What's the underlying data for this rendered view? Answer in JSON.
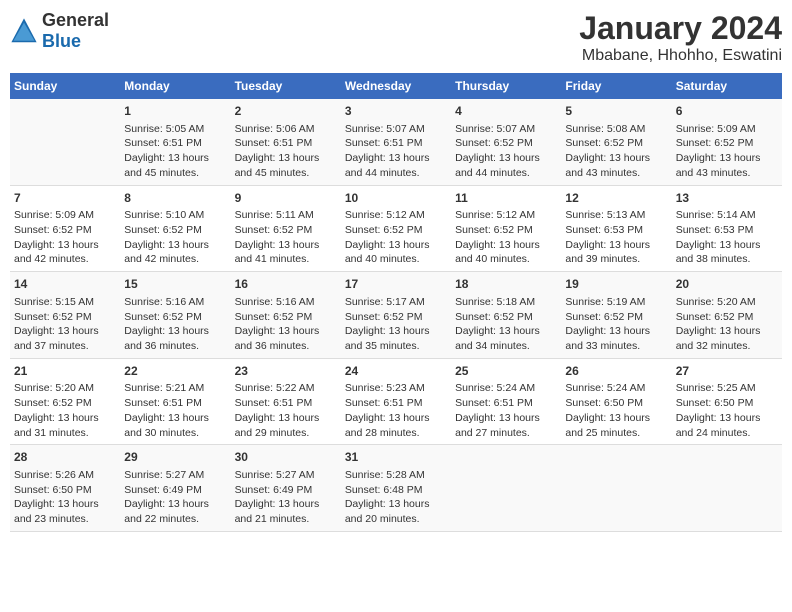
{
  "header": {
    "logo": {
      "general": "General",
      "blue": "Blue"
    },
    "title": "January 2024",
    "subtitle": "Mbabane, Hhohho, Eswatini"
  },
  "weekdays": [
    "Sunday",
    "Monday",
    "Tuesday",
    "Wednesday",
    "Thursday",
    "Friday",
    "Saturday"
  ],
  "weeks": [
    [
      {
        "day": "",
        "sunrise": "",
        "sunset": "",
        "daylight": ""
      },
      {
        "day": "1",
        "sunrise": "Sunrise: 5:05 AM",
        "sunset": "Sunset: 6:51 PM",
        "daylight": "Daylight: 13 hours and 45 minutes."
      },
      {
        "day": "2",
        "sunrise": "Sunrise: 5:06 AM",
        "sunset": "Sunset: 6:51 PM",
        "daylight": "Daylight: 13 hours and 45 minutes."
      },
      {
        "day": "3",
        "sunrise": "Sunrise: 5:07 AM",
        "sunset": "Sunset: 6:51 PM",
        "daylight": "Daylight: 13 hours and 44 minutes."
      },
      {
        "day": "4",
        "sunrise": "Sunrise: 5:07 AM",
        "sunset": "Sunset: 6:52 PM",
        "daylight": "Daylight: 13 hours and 44 minutes."
      },
      {
        "day": "5",
        "sunrise": "Sunrise: 5:08 AM",
        "sunset": "Sunset: 6:52 PM",
        "daylight": "Daylight: 13 hours and 43 minutes."
      },
      {
        "day": "6",
        "sunrise": "Sunrise: 5:09 AM",
        "sunset": "Sunset: 6:52 PM",
        "daylight": "Daylight: 13 hours and 43 minutes."
      }
    ],
    [
      {
        "day": "7",
        "sunrise": "Sunrise: 5:09 AM",
        "sunset": "Sunset: 6:52 PM",
        "daylight": "Daylight: 13 hours and 42 minutes."
      },
      {
        "day": "8",
        "sunrise": "Sunrise: 5:10 AM",
        "sunset": "Sunset: 6:52 PM",
        "daylight": "Daylight: 13 hours and 42 minutes."
      },
      {
        "day": "9",
        "sunrise": "Sunrise: 5:11 AM",
        "sunset": "Sunset: 6:52 PM",
        "daylight": "Daylight: 13 hours and 41 minutes."
      },
      {
        "day": "10",
        "sunrise": "Sunrise: 5:12 AM",
        "sunset": "Sunset: 6:52 PM",
        "daylight": "Daylight: 13 hours and 40 minutes."
      },
      {
        "day": "11",
        "sunrise": "Sunrise: 5:12 AM",
        "sunset": "Sunset: 6:52 PM",
        "daylight": "Daylight: 13 hours and 40 minutes."
      },
      {
        "day": "12",
        "sunrise": "Sunrise: 5:13 AM",
        "sunset": "Sunset: 6:53 PM",
        "daylight": "Daylight: 13 hours and 39 minutes."
      },
      {
        "day": "13",
        "sunrise": "Sunrise: 5:14 AM",
        "sunset": "Sunset: 6:53 PM",
        "daylight": "Daylight: 13 hours and 38 minutes."
      }
    ],
    [
      {
        "day": "14",
        "sunrise": "Sunrise: 5:15 AM",
        "sunset": "Sunset: 6:52 PM",
        "daylight": "Daylight: 13 hours and 37 minutes."
      },
      {
        "day": "15",
        "sunrise": "Sunrise: 5:16 AM",
        "sunset": "Sunset: 6:52 PM",
        "daylight": "Daylight: 13 hours and 36 minutes."
      },
      {
        "day": "16",
        "sunrise": "Sunrise: 5:16 AM",
        "sunset": "Sunset: 6:52 PM",
        "daylight": "Daylight: 13 hours and 36 minutes."
      },
      {
        "day": "17",
        "sunrise": "Sunrise: 5:17 AM",
        "sunset": "Sunset: 6:52 PM",
        "daylight": "Daylight: 13 hours and 35 minutes."
      },
      {
        "day": "18",
        "sunrise": "Sunrise: 5:18 AM",
        "sunset": "Sunset: 6:52 PM",
        "daylight": "Daylight: 13 hours and 34 minutes."
      },
      {
        "day": "19",
        "sunrise": "Sunrise: 5:19 AM",
        "sunset": "Sunset: 6:52 PM",
        "daylight": "Daylight: 13 hours and 33 minutes."
      },
      {
        "day": "20",
        "sunrise": "Sunrise: 5:20 AM",
        "sunset": "Sunset: 6:52 PM",
        "daylight": "Daylight: 13 hours and 32 minutes."
      }
    ],
    [
      {
        "day": "21",
        "sunrise": "Sunrise: 5:20 AM",
        "sunset": "Sunset: 6:52 PM",
        "daylight": "Daylight: 13 hours and 31 minutes."
      },
      {
        "day": "22",
        "sunrise": "Sunrise: 5:21 AM",
        "sunset": "Sunset: 6:51 PM",
        "daylight": "Daylight: 13 hours and 30 minutes."
      },
      {
        "day": "23",
        "sunrise": "Sunrise: 5:22 AM",
        "sunset": "Sunset: 6:51 PM",
        "daylight": "Daylight: 13 hours and 29 minutes."
      },
      {
        "day": "24",
        "sunrise": "Sunrise: 5:23 AM",
        "sunset": "Sunset: 6:51 PM",
        "daylight": "Daylight: 13 hours and 28 minutes."
      },
      {
        "day": "25",
        "sunrise": "Sunrise: 5:24 AM",
        "sunset": "Sunset: 6:51 PM",
        "daylight": "Daylight: 13 hours and 27 minutes."
      },
      {
        "day": "26",
        "sunrise": "Sunrise: 5:24 AM",
        "sunset": "Sunset: 6:50 PM",
        "daylight": "Daylight: 13 hours and 25 minutes."
      },
      {
        "day": "27",
        "sunrise": "Sunrise: 5:25 AM",
        "sunset": "Sunset: 6:50 PM",
        "daylight": "Daylight: 13 hours and 24 minutes."
      }
    ],
    [
      {
        "day": "28",
        "sunrise": "Sunrise: 5:26 AM",
        "sunset": "Sunset: 6:50 PM",
        "daylight": "Daylight: 13 hours and 23 minutes."
      },
      {
        "day": "29",
        "sunrise": "Sunrise: 5:27 AM",
        "sunset": "Sunset: 6:49 PM",
        "daylight": "Daylight: 13 hours and 22 minutes."
      },
      {
        "day": "30",
        "sunrise": "Sunrise: 5:27 AM",
        "sunset": "Sunset: 6:49 PM",
        "daylight": "Daylight: 13 hours and 21 minutes."
      },
      {
        "day": "31",
        "sunrise": "Sunrise: 5:28 AM",
        "sunset": "Sunset: 6:48 PM",
        "daylight": "Daylight: 13 hours and 20 minutes."
      },
      {
        "day": "",
        "sunrise": "",
        "sunset": "",
        "daylight": ""
      },
      {
        "day": "",
        "sunrise": "",
        "sunset": "",
        "daylight": ""
      },
      {
        "day": "",
        "sunrise": "",
        "sunset": "",
        "daylight": ""
      }
    ]
  ]
}
